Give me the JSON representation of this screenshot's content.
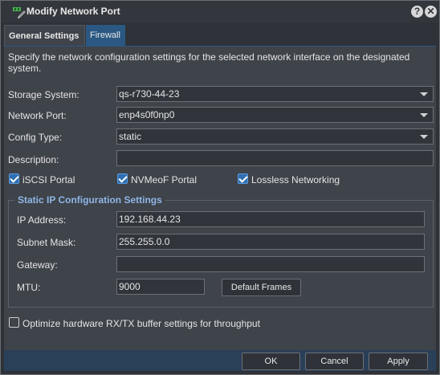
{
  "window": {
    "title": "Modify Network Port",
    "help_glyph": "?",
    "close_glyph": "✕"
  },
  "tabs": [
    {
      "label": "General Settings",
      "active": true
    },
    {
      "label": "Firewall",
      "active": false
    }
  ],
  "description": "Specify the network configuration settings for the selected network interface on the designated system.",
  "form": {
    "storage_system": {
      "label": "Storage System:",
      "value": "qs-r730-44-23"
    },
    "network_port": {
      "label": "Network Port:",
      "value": "enp4s0f0np0"
    },
    "config_type": {
      "label": "Config Type:",
      "value": "static"
    },
    "description": {
      "label": "Description:",
      "value": ""
    }
  },
  "checkboxes": {
    "iscsi": {
      "label": "iSCSI Portal",
      "checked": true
    },
    "nvmeof": {
      "label": "NVMeoF Portal",
      "checked": true
    },
    "lossless": {
      "label": "Lossless Networking",
      "checked": true
    },
    "optimize": {
      "label": "Optimize hardware RX/TX buffer settings for throughput",
      "checked": false
    }
  },
  "static_ip": {
    "legend": "Static IP Configuration Settings",
    "ip_address": {
      "label": "IP Address:",
      "value": "192.168.44.23"
    },
    "subnet_mask": {
      "label": "Subnet Mask:",
      "value": "255.255.0.0"
    },
    "gateway": {
      "label": "Gateway:",
      "value": ""
    },
    "mtu": {
      "label": "MTU:",
      "value": "9000"
    },
    "default_frames_label": "Default Frames"
  },
  "buttons": {
    "ok": "OK",
    "cancel": "Cancel",
    "apply": "Apply"
  },
  "colors": {
    "accent": "#2a5883",
    "legend": "#8fb6e6",
    "checkbox": "#2f6fb1"
  }
}
